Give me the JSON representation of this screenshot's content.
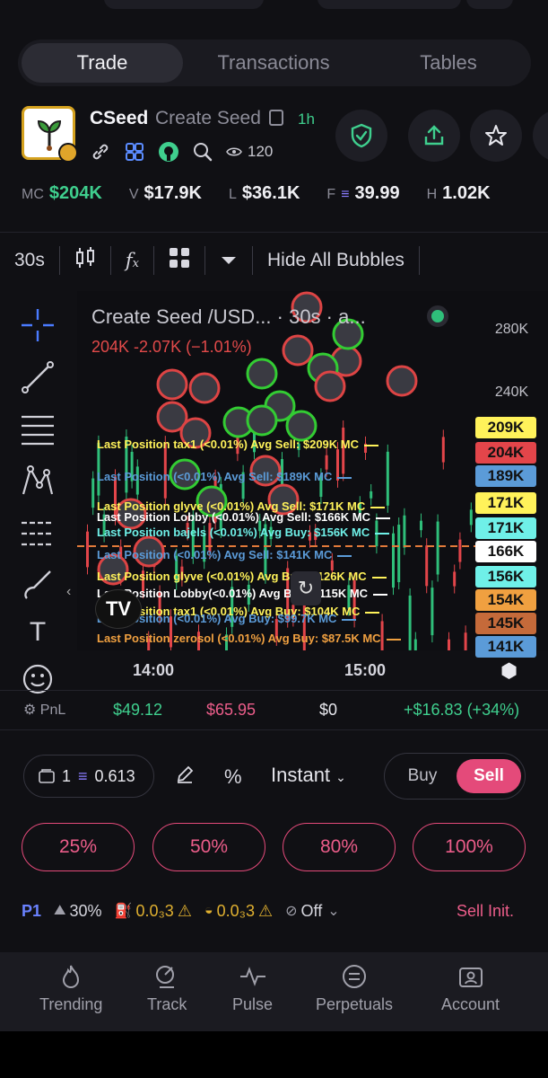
{
  "tabs": [
    "Trade",
    "Transactions",
    "Tables"
  ],
  "token": {
    "symbol": "CSeed",
    "name": "Create Seed",
    "age": "1h",
    "views": "120"
  },
  "stats": [
    {
      "key": "MC",
      "value": "$204K"
    },
    {
      "key": "V",
      "value": "$17.9K"
    },
    {
      "key": "L",
      "value": "$36.1K"
    },
    {
      "key": "F",
      "value": "39.99"
    },
    {
      "key": "H",
      "value": "1.02K"
    }
  ],
  "chart_toolbar": {
    "interval": "30s",
    "hide_bubbles": "Hide All Bubbles"
  },
  "chart": {
    "title": "Create Seed /USD... · 30s · a...",
    "subtitle": "204K  -2.07K (−1.01%)",
    "y_ticks": [
      "280K",
      "240K"
    ],
    "x_ticks": [
      "14:00",
      "15:00"
    ],
    "price_tags": [
      {
        "label": "209K",
        "color": "#fff25a"
      },
      {
        "label": "204K",
        "color": "#e3454a"
      },
      {
        "label": "189K",
        "color": "#5b9bd8"
      },
      {
        "label": "171K",
        "color": "#fff25a"
      },
      {
        "label": "171K",
        "color": "#6ff0e8"
      },
      {
        "label": "166K",
        "color": "#ffffff"
      },
      {
        "label": "156K",
        "color": "#6ff0e8"
      },
      {
        "label": "154K",
        "color": "#f0a040"
      },
      {
        "label": "145K",
        "color": "#c56a3a"
      },
      {
        "label": "141K",
        "color": "#5b9bd8"
      }
    ],
    "position_lines": [
      {
        "text": "Last Position tax1 (<0.01%) Avg Sell: $209K MC",
        "color": "#fff25a"
      },
      {
        "text": "Last Position (<0.01%) Avg Sell: $189K MC",
        "color": "#5b9bd8"
      },
      {
        "text": "Last Position glyve (<0.01%) Avg Sell: $171K MC",
        "color": "#fff25a"
      },
      {
        "text": "Last Position Lobby (<0.01%) Avg Sell: $166K MC",
        "color": "#ffffff"
      },
      {
        "text": "Last Position bajels (<0.01%) Avg Buy: $156K MC",
        "color": "#6ff0e8"
      },
      {
        "text": "Last Position (<0.01%) Avg Sell: $141K MC",
        "color": "#5b9bd8"
      },
      {
        "text": "Last Position glyve (<0.01%) Avg Buy: $126K MC",
        "color": "#fff25a"
      },
      {
        "text": "Last Position Lobby(<0.01%) Avg Buy: $115K MC",
        "color": "#ffffff"
      },
      {
        "text": "Last Position tax1 (<0.01%) Avg Buy: $104K MC",
        "color": "#fff25a"
      },
      {
        "text": "Last Position (<0.01%) Avg Buy: $99.7K MC",
        "color": "#5b9bd8"
      },
      {
        "text": "Last Position zerosol (<0.01%) Avg Buy: $87.5K MC",
        "color": "#f0a040"
      }
    ]
  },
  "pnl": {
    "label": "PnL",
    "bought": "$49.12",
    "sold": "$65.95",
    "holding": "$0",
    "total": "+$16.83 (+34%)"
  },
  "order": {
    "wallet_count": "1",
    "balance": "0.613",
    "percent_symbol": "%",
    "mode": "Instant",
    "buy": "Buy",
    "sell": "Sell",
    "presets": [
      "25%",
      "50%",
      "80%",
      "100%"
    ]
  },
  "settings": {
    "preset": "P1",
    "slippage": "30%",
    "priority": "0.0₃3",
    "bribe": "0.0₃3",
    "mev": "Off",
    "sell_init": "Sell Init."
  },
  "nav": [
    "Trending",
    "Track",
    "Pulse",
    "Perpetuals",
    "Account"
  ]
}
